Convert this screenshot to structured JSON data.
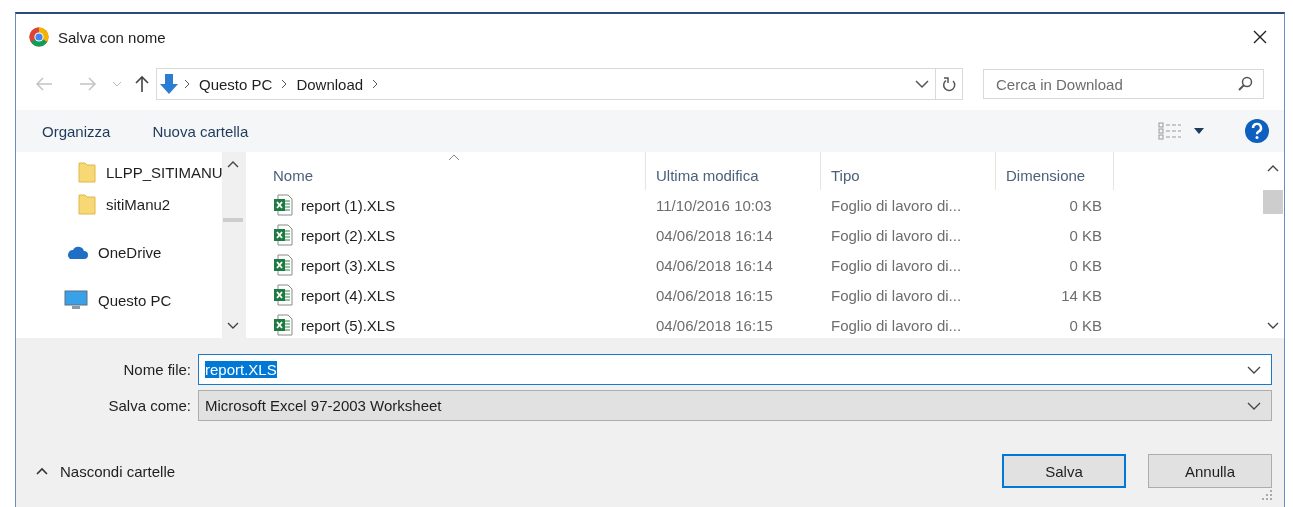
{
  "window": {
    "title": "Salva con nome"
  },
  "navigation": {
    "back_disabled": true,
    "forward_disabled": true,
    "path": [
      "Questo PC",
      "Download"
    ]
  },
  "search": {
    "placeholder": "Cerca in Download"
  },
  "toolbar": {
    "organize": "Organizza",
    "new_folder": "Nuova cartella"
  },
  "sidebar": {
    "items": [
      {
        "label": "LLPP_SITIMANU",
        "kind": "folder"
      },
      {
        "label": "sitiManu2",
        "kind": "folder"
      },
      {
        "label": "OneDrive",
        "kind": "cloud"
      },
      {
        "label": "Questo PC",
        "kind": "computer"
      }
    ]
  },
  "table": {
    "columns": [
      {
        "label": "Nome",
        "sorted": true
      },
      {
        "label": "Ultima modifica",
        "sorted": false
      },
      {
        "label": "Tipo",
        "sorted": false
      },
      {
        "label": "Dimensione",
        "sorted": false
      }
    ],
    "rows": [
      {
        "name": "report (1).XLS",
        "modified": "11/10/2016 10:03",
        "type": "Foglio di lavoro di...",
        "size": "0 KB"
      },
      {
        "name": "report (2).XLS",
        "modified": "04/06/2018 16:14",
        "type": "Foglio di lavoro di...",
        "size": "0 KB"
      },
      {
        "name": "report (3).XLS",
        "modified": "04/06/2018 16:14",
        "type": "Foglio di lavoro di...",
        "size": "0 KB"
      },
      {
        "name": "report (4).XLS",
        "modified": "04/06/2018 16:15",
        "type": "Foglio di lavoro di...",
        "size": "14 KB"
      },
      {
        "name": "report (5).XLS",
        "modified": "04/06/2018 16:15",
        "type": "Foglio di lavoro di...",
        "size": "0 KB"
      }
    ]
  },
  "form": {
    "filename_label": "Nome file:",
    "filename": "report.XLS",
    "filename_selected": true,
    "type_label": "Salva come:",
    "type": "Microsoft Excel 97-2003 Worksheet"
  },
  "hide_folders": "Nascondi cartelle",
  "buttons": [
    {
      "label": "Salva",
      "default": true
    },
    {
      "label": "Annulla",
      "default": false
    }
  ]
}
